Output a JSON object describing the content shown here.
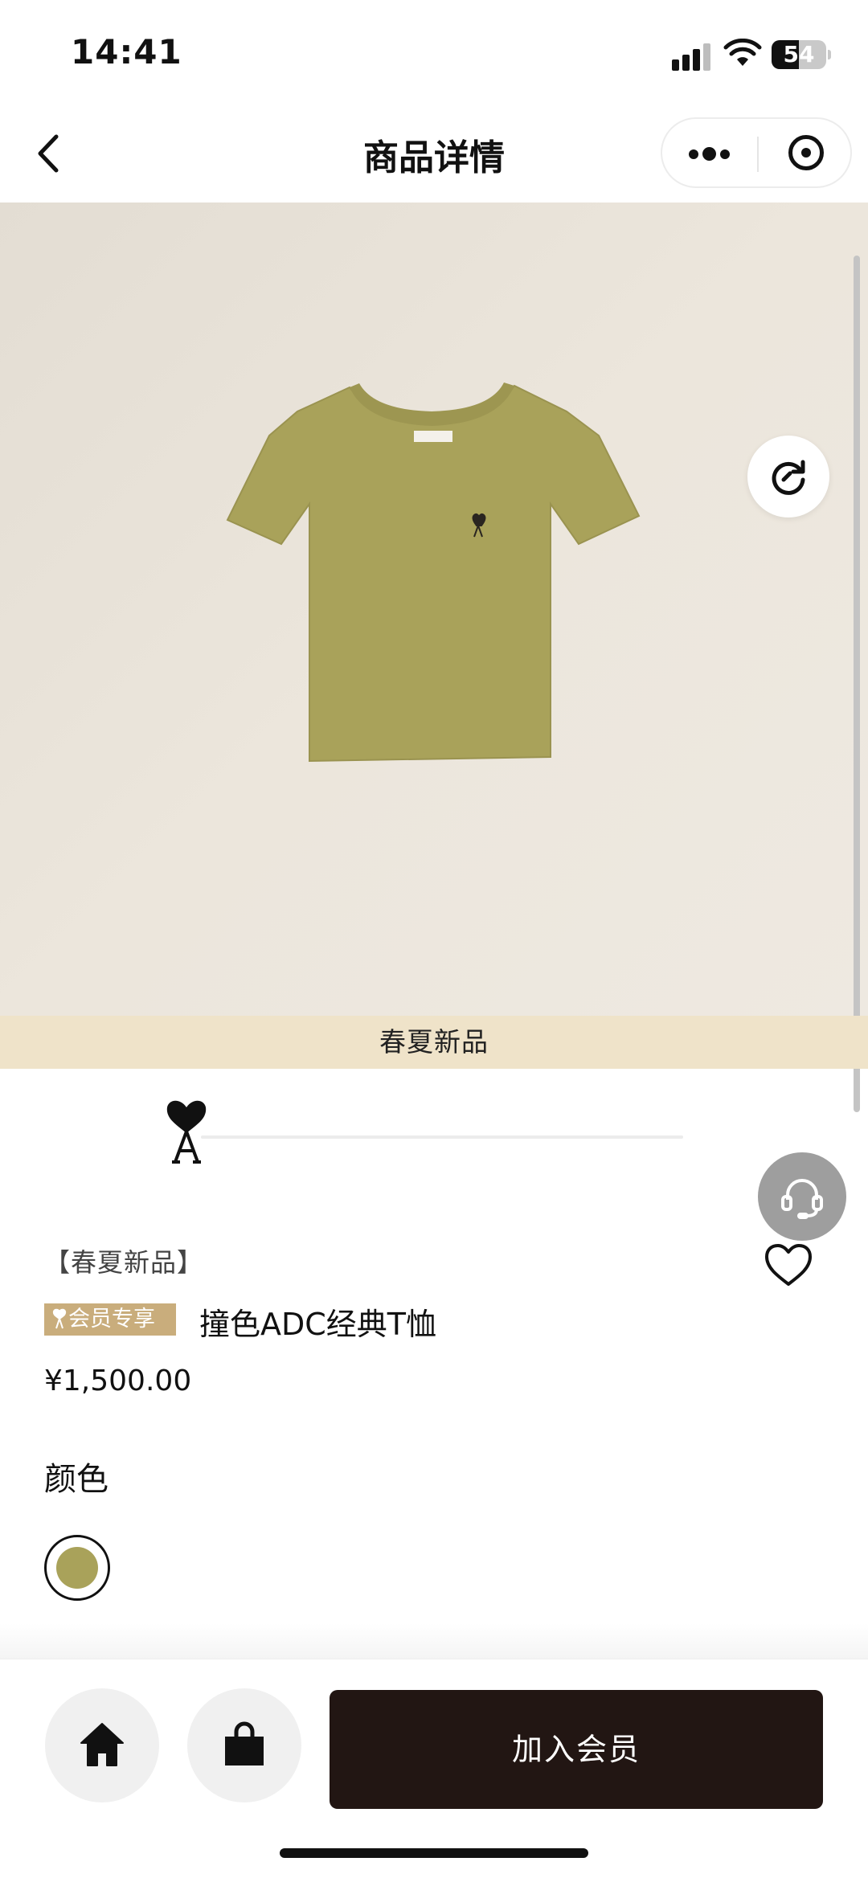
{
  "status_bar": {
    "time": "14:41",
    "battery": "54"
  },
  "nav": {
    "title": "商品详情"
  },
  "product": {
    "season_banner": "春夏新品",
    "tag": "【春夏新品】",
    "member_badge": "会员专享",
    "name": "撞色ADC经典T恤",
    "price": "¥1,500.00",
    "image_progress": 0,
    "image_color": "#a9a25a"
  },
  "options": {
    "color_label": "颜色",
    "colors": [
      {
        "swatch": "#a9a25a",
        "selected": true
      }
    ]
  },
  "bottom_bar": {
    "join_label": "加入会员"
  },
  "colors": {
    "member_badge": "#c9ad7c",
    "season_banner": "#efe3c9",
    "join_button": "#221613"
  },
  "icons": [
    "chevron-left-icon",
    "more-dots-icon",
    "target-icon",
    "refresh-icon",
    "brand-logo-icon",
    "headset-icon",
    "heart-icon",
    "home-icon",
    "shopping-bag-icon"
  ]
}
